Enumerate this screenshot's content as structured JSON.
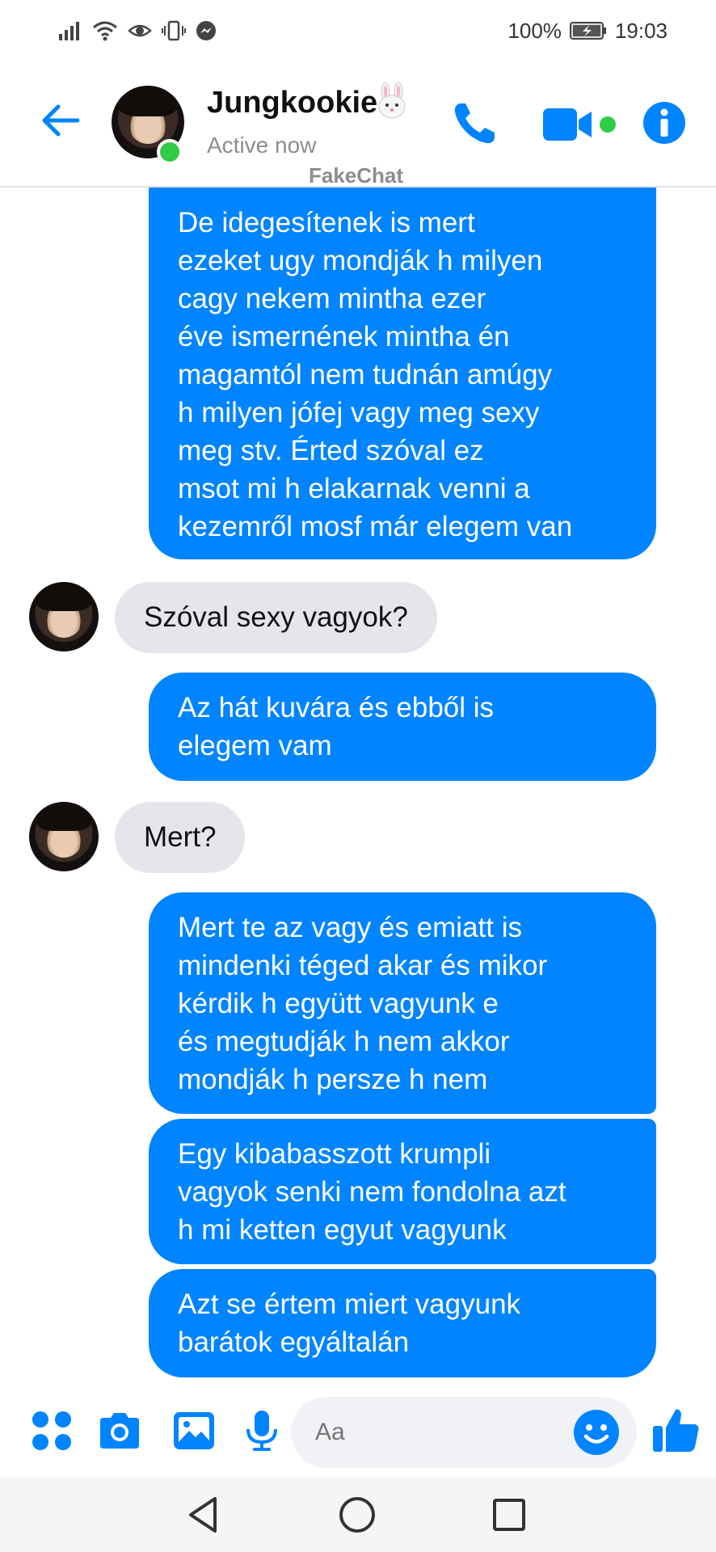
{
  "status_bar": {
    "battery_percent": "100%",
    "time": "19:03"
  },
  "header": {
    "contact_name": "Jungkookie",
    "active_status": "Active now",
    "watermark": "FakeChat",
    "accent_color": "#0084ff",
    "online_color": "#31cc46"
  },
  "messages": [
    {
      "direction": "out",
      "text": "De idegesítenek is mert\nezeket ugy mondják h milyen\ncagy nekem mintha ezer\néve ismernének mintha én\nmagamtól nem tudnán amúgy\nh milyen jófej vagy meg sexy\nmeg stv. Érted szóval ez\nmsot mi h elakarnak venni a\nkezemről mosf már elegem van"
    },
    {
      "direction": "in",
      "text": "Szóval sexy vagyok?"
    },
    {
      "direction": "out",
      "text": "Az hát kuvára és ebből is\nelegem vam"
    },
    {
      "direction": "in",
      "text": "Mert?"
    },
    {
      "direction": "out",
      "text": "Mert te az vagy és emiatt is\nmindenki téged akar és mikor\nkérdik h együtt vagyunk e\nés megtudják h nem akkor\nmondják h persze h nem"
    },
    {
      "direction": "out",
      "text": "Egy kibabasszott krumpli\nvagyok senki nem fondolna azt\nh mi ketten egyut vagyunk"
    },
    {
      "direction": "out",
      "text": "Azt se értem miert vagyunk\nbarátok egyáltalán"
    }
  ],
  "composer": {
    "placeholder": "Aa"
  }
}
